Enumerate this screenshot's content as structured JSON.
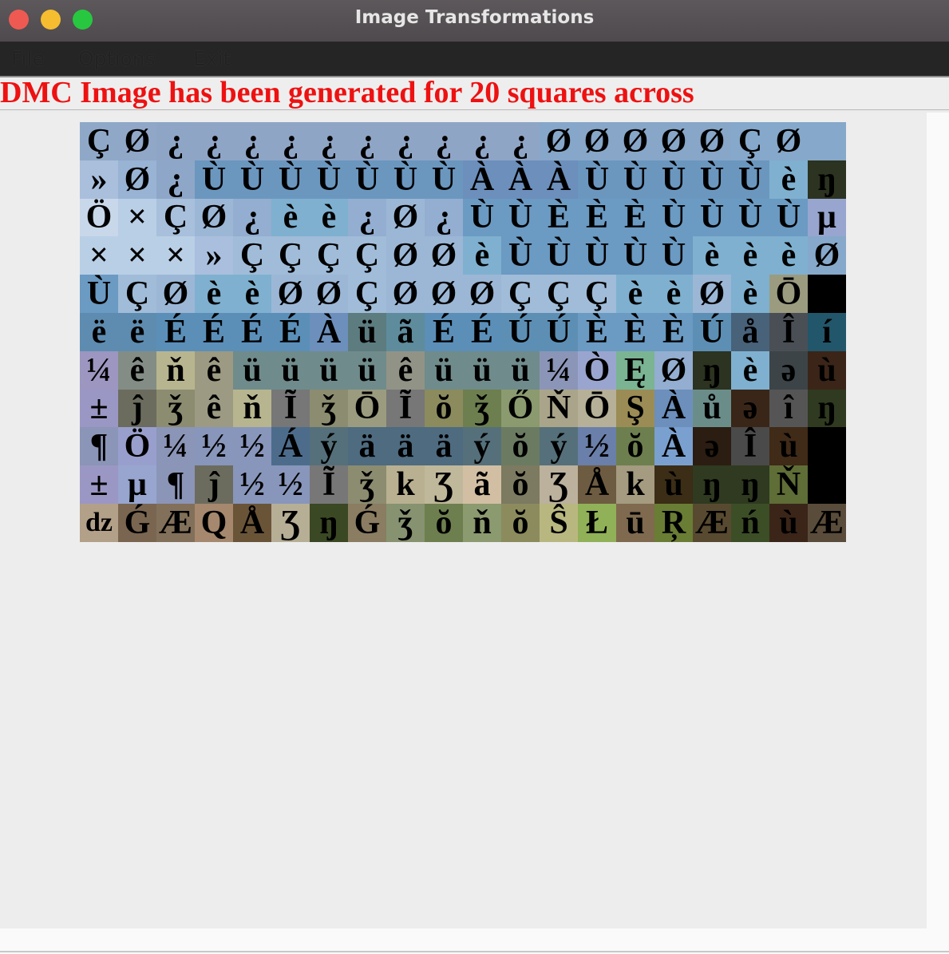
{
  "window": {
    "title": "Image Transformations"
  },
  "menu": {
    "items": [
      "File",
      "Options",
      "Exit"
    ]
  },
  "status": {
    "message": "DMC Image has been generated for 20 squares across"
  },
  "mosaic": {
    "rows": [
      {
        "symbols": [
          "Ç",
          "Ø",
          "¿",
          "¿",
          "¿",
          "¿",
          "¿",
          "¿",
          "¿",
          "¿",
          "¿",
          "¿",
          "Ø",
          "Ø",
          "Ø",
          "Ø",
          "Ø",
          "Ç",
          "Ø",
          ""
        ],
        "colors": [
          "#8fa8c8",
          "#90a7c8",
          "#8ea5c6",
          "#8fa5c6",
          "#8fa5c6",
          "#8fa5c6",
          "#8fa5c6",
          "#8fa5c6",
          "#8fa5c6",
          "#8fa5c6",
          "#8fa5c6",
          "#8fa5c6",
          "#86a7c9",
          "#87a6c8",
          "#87a6c8",
          "#87a6c8",
          "#87a6c8",
          "#86a8ca",
          "#86a8ca",
          "#86a8ca"
        ]
      },
      {
        "symbols": [
          "»",
          "Ø",
          "¿",
          "Ù",
          "Ù",
          "Ù",
          "Ù",
          "Ù",
          "Ù",
          "Ù",
          "À",
          "À",
          "À",
          "Ù",
          "Ù",
          "Ù",
          "Ù",
          "Ù",
          "è",
          "ŋ"
        ],
        "colors": [
          "#a9bfdc",
          "#98b3d4",
          "#8ea7c8",
          "#6b97bf",
          "#6b97bf",
          "#6b97bf",
          "#6b97bf",
          "#6b97bf",
          "#6b97bf",
          "#6b97bf",
          "#6c8fbc",
          "#6c8fbc",
          "#6c8fbc",
          "#6b97bf",
          "#6b97bf",
          "#6b97bf",
          "#6b97bf",
          "#6b97bf",
          "#7fb0cf",
          "#2c3320"
        ]
      },
      {
        "symbols": [
          "Ö",
          "×",
          "Ç",
          "Ø",
          "¿",
          "è",
          "è",
          "¿",
          "Ø",
          "¿",
          "Ù",
          "Ù",
          "È",
          "È",
          "È",
          "Ù",
          "Ù",
          "Ù",
          "Ù",
          "µ"
        ],
        "colors": [
          "#c8d7ea",
          "#b9cfe6",
          "#a8c0dc",
          "#9cb7d6",
          "#93aed0",
          "#7fb0cf",
          "#7fb0cf",
          "#93aed0",
          "#9cb7d6",
          "#93aed0",
          "#6b9ac2",
          "#6b9ac2",
          "#6b9ac2",
          "#6b9ac2",
          "#6b9ac2",
          "#6b9ac2",
          "#6b9ac2",
          "#6b9ac2",
          "#6b9ac2",
          "#97a5cf"
        ]
      },
      {
        "symbols": [
          "×",
          "×",
          "×",
          "»",
          "Ç",
          "Ç",
          "Ç",
          "Ç",
          "Ø",
          "Ø",
          "è",
          "Ù",
          "Ù",
          "Ù",
          "Ù",
          "Ù",
          "è",
          "è",
          "è",
          "Ø"
        ],
        "colors": [
          "#b9cfe6",
          "#b9cfe6",
          "#b9cfe6",
          "#aabfdd",
          "#a0bcd8",
          "#a0bcd8",
          "#a0bcd8",
          "#a0bcd8",
          "#9cb7d6",
          "#9cb7d6",
          "#7fb0cf",
          "#6b9ac2",
          "#6b9ac2",
          "#6b9ac2",
          "#6b9ac2",
          "#6b9ac2",
          "#7fb0cf",
          "#7fb0cf",
          "#7fb0cf",
          "#86a8ca"
        ]
      },
      {
        "symbols": [
          "Ù",
          "Ç",
          "Ø",
          "è",
          "è",
          "Ø",
          "Ø",
          "Ç",
          "Ø",
          "Ø",
          "Ø",
          "Ç",
          "Ç",
          "Ç",
          "è",
          "è",
          "Ø",
          "è",
          "Ō",
          ""
        ],
        "colors": [
          "#6b9ac2",
          "#a0bcd8",
          "#9cb7d6",
          "#7fb0cf",
          "#7fb0cf",
          "#9cb7d6",
          "#9cb7d6",
          "#a0bcd8",
          "#9cb7d6",
          "#9cb7d6",
          "#9cb7d6",
          "#a0bcd8",
          "#a0bcd8",
          "#a0bcd8",
          "#7fb0cf",
          "#7fb0cf",
          "#9cb7d6",
          "#7fb0cf",
          "#9b9b80",
          "#000000"
        ]
      },
      {
        "symbols": [
          "ë",
          "ë",
          "É",
          "É",
          "É",
          "É",
          "À",
          "ü",
          "ã",
          "É",
          "É",
          "Ú",
          "Ú",
          "È",
          "È",
          "È",
          "Ú",
          "å",
          "Î",
          "í"
        ],
        "colors": [
          "#5e8cb0",
          "#5e8cb0",
          "#5b8fb8",
          "#5b8fb8",
          "#5b8fb8",
          "#5b8fb8",
          "#6c8fbc",
          "#5d7c80",
          "#5e8c9c",
          "#5b8fb8",
          "#5b8fb8",
          "#5d8fb5",
          "#5d8fb5",
          "#6b9ac2",
          "#6b9ac2",
          "#6b9ac2",
          "#5d8fb5",
          "#48627a",
          "#4a4f55",
          "#22566a"
        ]
      },
      {
        "symbols": [
          "¼",
          "ê",
          "ň",
          "ê",
          "ü",
          "ü",
          "ü",
          "ü",
          "ê",
          "ü",
          "ü",
          "ü",
          "¼",
          "Ò",
          "Ę",
          "Ø",
          "ŋ",
          "è",
          "ə",
          "ù"
        ],
        "colors": [
          "#9c96c0",
          "#838d86",
          "#b7b58f",
          "#9c9a82",
          "#708b8b",
          "#708b8b",
          "#708b8b",
          "#708b8b",
          "#929387",
          "#708b8b",
          "#708b8b",
          "#708b8b",
          "#8b95b7",
          "#9aa5cf",
          "#7ab493",
          "#93aed0",
          "#2c3320",
          "#7fb0cf",
          "#3c4448",
          "#3b2518"
        ]
      },
      {
        "symbols": [
          "±",
          "ĵ",
          "ǯ",
          "ê",
          "ň",
          "Ĩ",
          "ǯ",
          "Ō",
          "Ĩ",
          "ŏ",
          "ǯ",
          "Ő",
          "Ň",
          "Ō",
          "Ş",
          "À",
          "ů",
          "ə",
          "î",
          "ŋ"
        ],
        "colors": [
          "#9b97c4",
          "#6c6c5e",
          "#8c8c70",
          "#9c9a82",
          "#b7b58f",
          "#777777",
          "#8c8c70",
          "#9b9b80",
          "#777777",
          "#8b8b5e",
          "#6d7f4e",
          "#8b9a6f",
          "#aaa58a",
          "#b6b098",
          "#9b8c56",
          "#6c8fbc",
          "#6b8d8a",
          "#3a2618",
          "#555555",
          "#2f3a20"
        ]
      },
      {
        "symbols": [
          "¶",
          "Ö",
          "¼",
          "½",
          "½",
          "Á",
          "ý",
          "ä",
          "ä",
          "ä",
          "ý",
          "ŏ",
          "ý",
          "½",
          "ŏ",
          "À",
          "ə",
          "Î",
          "ù",
          ""
        ],
        "colors": [
          "#8b95b7",
          "#999fcc",
          "#8b95b7",
          "#8896bb",
          "#8896bb",
          "#4d6c8c",
          "#55707a",
          "#4e6b80",
          "#4e6b80",
          "#4e6b80",
          "#55707a",
          "#6b7b62",
          "#55707a",
          "#6a7fa9",
          "#6d7f4e",
          "#7aa0cf",
          "#2b1d12",
          "#4a4a4a",
          "#402a18",
          "#000000"
        ]
      },
      {
        "symbols": [
          "±",
          "µ",
          "¶",
          "ĵ",
          "½",
          "½",
          "Ĩ",
          "ǯ",
          "k",
          "Ʒ",
          "ã",
          "ŏ",
          "Ʒ",
          "Å",
          "k",
          "ù",
          "ŋ",
          "ŋ",
          "Ň",
          ""
        ],
        "colors": [
          "#9b97c4",
          "#97a5cf",
          "#8b95b7",
          "#6c6c5e",
          "#8896bb",
          "#8896bb",
          "#777777",
          "#8c8c70",
          "#b8b090",
          "#c0b89a",
          "#d2bfa3",
          "#7c7a60",
          "#bcb19c",
          "#6e5c42",
          "#a49b80",
          "#3b2d16",
          "#2f3a20",
          "#2f3a20",
          "#5f6d36",
          "#000000"
        ]
      },
      {
        "symbols": [
          "dz",
          "Ǵ",
          "Æ",
          "Q",
          "Å",
          "Ʒ",
          "ŋ",
          "Ǵ",
          "ǯ",
          "ŏ",
          "ň",
          "ŏ",
          "Ŝ",
          "Ł",
          "ū",
          "Ŗ",
          "Æ",
          "ń",
          "ù",
          "Æ"
        ],
        "colors": [
          "#b3a089",
          "#7a6650",
          "#82705a",
          "#a5886d",
          "#6a5438",
          "#b7ae96",
          "#3b4824",
          "#8b7d62",
          "#869270",
          "#6d7f4e",
          "#8b9a6f",
          "#8b8b5e",
          "#b9b780",
          "#90b157",
          "#7f6a4f",
          "#6a7d34",
          "#584a30",
          "#3c4e26",
          "#3b2518",
          "#5a4c3a"
        ]
      }
    ]
  }
}
